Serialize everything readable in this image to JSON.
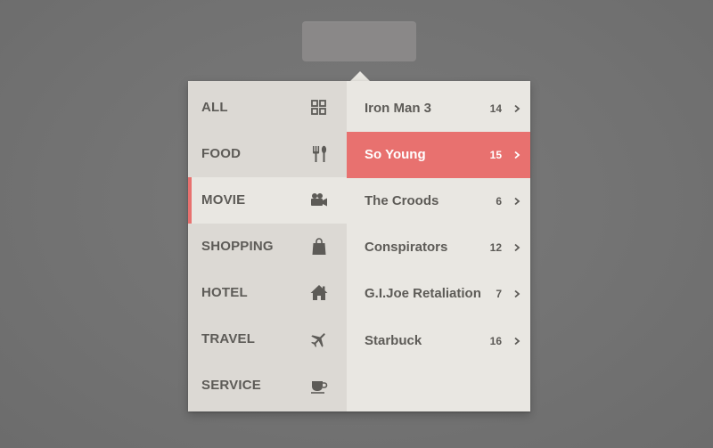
{
  "colors": {
    "accent": "#e8716f",
    "background": "#737373",
    "panel_left": "#dcd9d4",
    "panel_right": "#e9e7e2",
    "text": "#5d5b57"
  },
  "categories": [
    {
      "label": "ALL",
      "icon": "grid-icon"
    },
    {
      "label": "FOOD",
      "icon": "fork-knife-icon"
    },
    {
      "label": "MOVIE",
      "icon": "movie-camera-icon",
      "active": true
    },
    {
      "label": "SHOPPING",
      "icon": "shopping-bag-icon"
    },
    {
      "label": "HOTEL",
      "icon": "house-icon"
    },
    {
      "label": "TRAVEL",
      "icon": "airplane-icon"
    },
    {
      "label": "SERVICE",
      "icon": "coffee-cup-icon"
    }
  ],
  "items": [
    {
      "title": "Iron Man 3",
      "count": "14"
    },
    {
      "title": "So Young",
      "count": "15",
      "selected": true
    },
    {
      "title": "The Croods",
      "count": "6"
    },
    {
      "title": "Conspirators",
      "count": "12"
    },
    {
      "title": "G.I.Joe Retaliation",
      "count": "7"
    },
    {
      "title": "Starbuck",
      "count": "16"
    }
  ]
}
